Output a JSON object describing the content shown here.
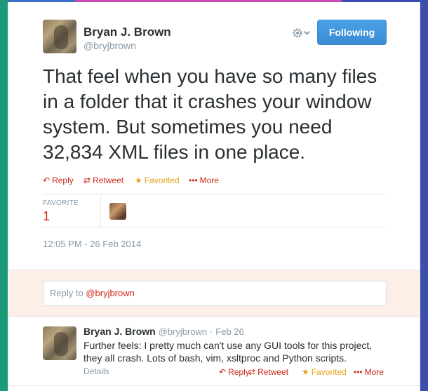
{
  "tweet": {
    "author_name": "Bryan J. Brown",
    "author_handle": "@bryjbrown",
    "follow_label": "Following",
    "settings_icon": "gear-icon",
    "text": "That feel when you have so many files in a folder that it crashes your window system. But sometimes you need 32,834 XML files in one place.",
    "actions": {
      "reply": "Reply",
      "retweet": "Retweet",
      "favorited": "Favorited",
      "more": "More"
    },
    "favorites": {
      "label": "FAVORITE",
      "count": "1"
    },
    "timestamp": "12:05 PM - 26 Feb 2014"
  },
  "reply_box": {
    "prefix": "Reply to ",
    "mention": "@bryjbrown"
  },
  "reply_tweet": {
    "author_name": "Bryan J. Brown",
    "author_handle": "@bryjbrown",
    "separator": "·",
    "date": "Feb 26",
    "text": "Further feels: I pretty much can't use any GUI tools for this project, they all crash. Lots of bash, vim, xsltproc and Python scripts.",
    "details": "Details",
    "actions": {
      "reply": "Reply",
      "retweet": "Retweet",
      "favorited": "Favorited",
      "more": "More"
    }
  },
  "colors": {
    "accent": "#cc2a1a",
    "favorite": "#e8a21b",
    "follow_button": "#3b8bd2",
    "reply_band": "#fdeee8"
  }
}
